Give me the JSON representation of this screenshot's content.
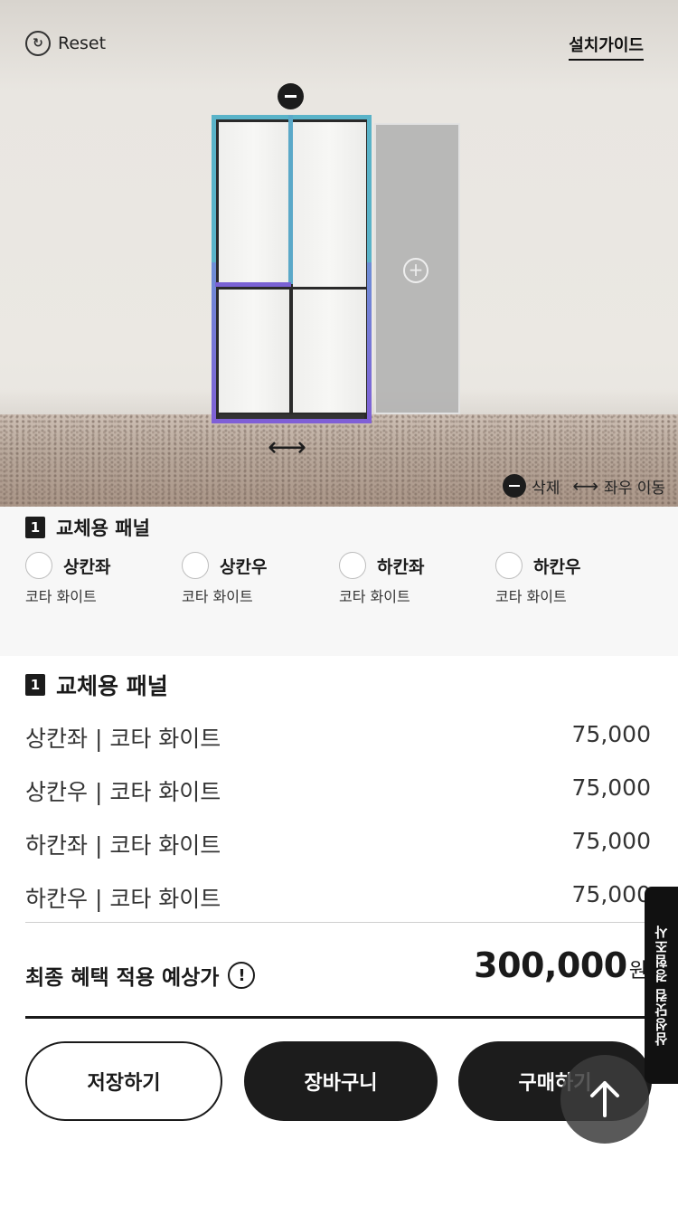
{
  "scene": {
    "reset_label": "Reset",
    "reset_icon": "↻",
    "guide_label": "설치가이드",
    "legend": {
      "remove_label": "삭제",
      "move_label": "좌우 이동",
      "move_icon": "⟷"
    },
    "add_icon": "+",
    "move_icon": "⟷"
  },
  "options": {
    "number": "1",
    "title": "교체용 패널",
    "items": [
      {
        "name": "상칸좌",
        "color": "코타 화이트"
      },
      {
        "name": "상칸우",
        "color": "코타 화이트"
      },
      {
        "name": "하칸좌",
        "color": "코타 화이트"
      },
      {
        "name": "하칸우",
        "color": "코타 화이트"
      }
    ]
  },
  "summary": {
    "number": "1",
    "title": "교체용 패널",
    "rows": [
      {
        "label": "상칸좌 | 코타 화이트",
        "price": "75,000"
      },
      {
        "label": "상칸우 | 코타 화이트",
        "price": "75,000"
      },
      {
        "label": "하칸좌 | 코타 화이트",
        "price": "75,000"
      },
      {
        "label": "하칸우 | 코타 화이트",
        "price": "75,000"
      }
    ],
    "total_label": "최종 혜택 적용 예상가",
    "info_icon": "!",
    "total_value": "300,000",
    "total_unit": "원"
  },
  "actions": {
    "save_label": "저장하기",
    "cart_label": "장바구니",
    "buy_label": "구매하기"
  },
  "side_tab_label": "삼성닷컴 경험조사",
  "colors": {
    "accent_teal": "#5ab3c8",
    "accent_purple": "#7f5fd6",
    "dark": "#1c1c1c"
  }
}
